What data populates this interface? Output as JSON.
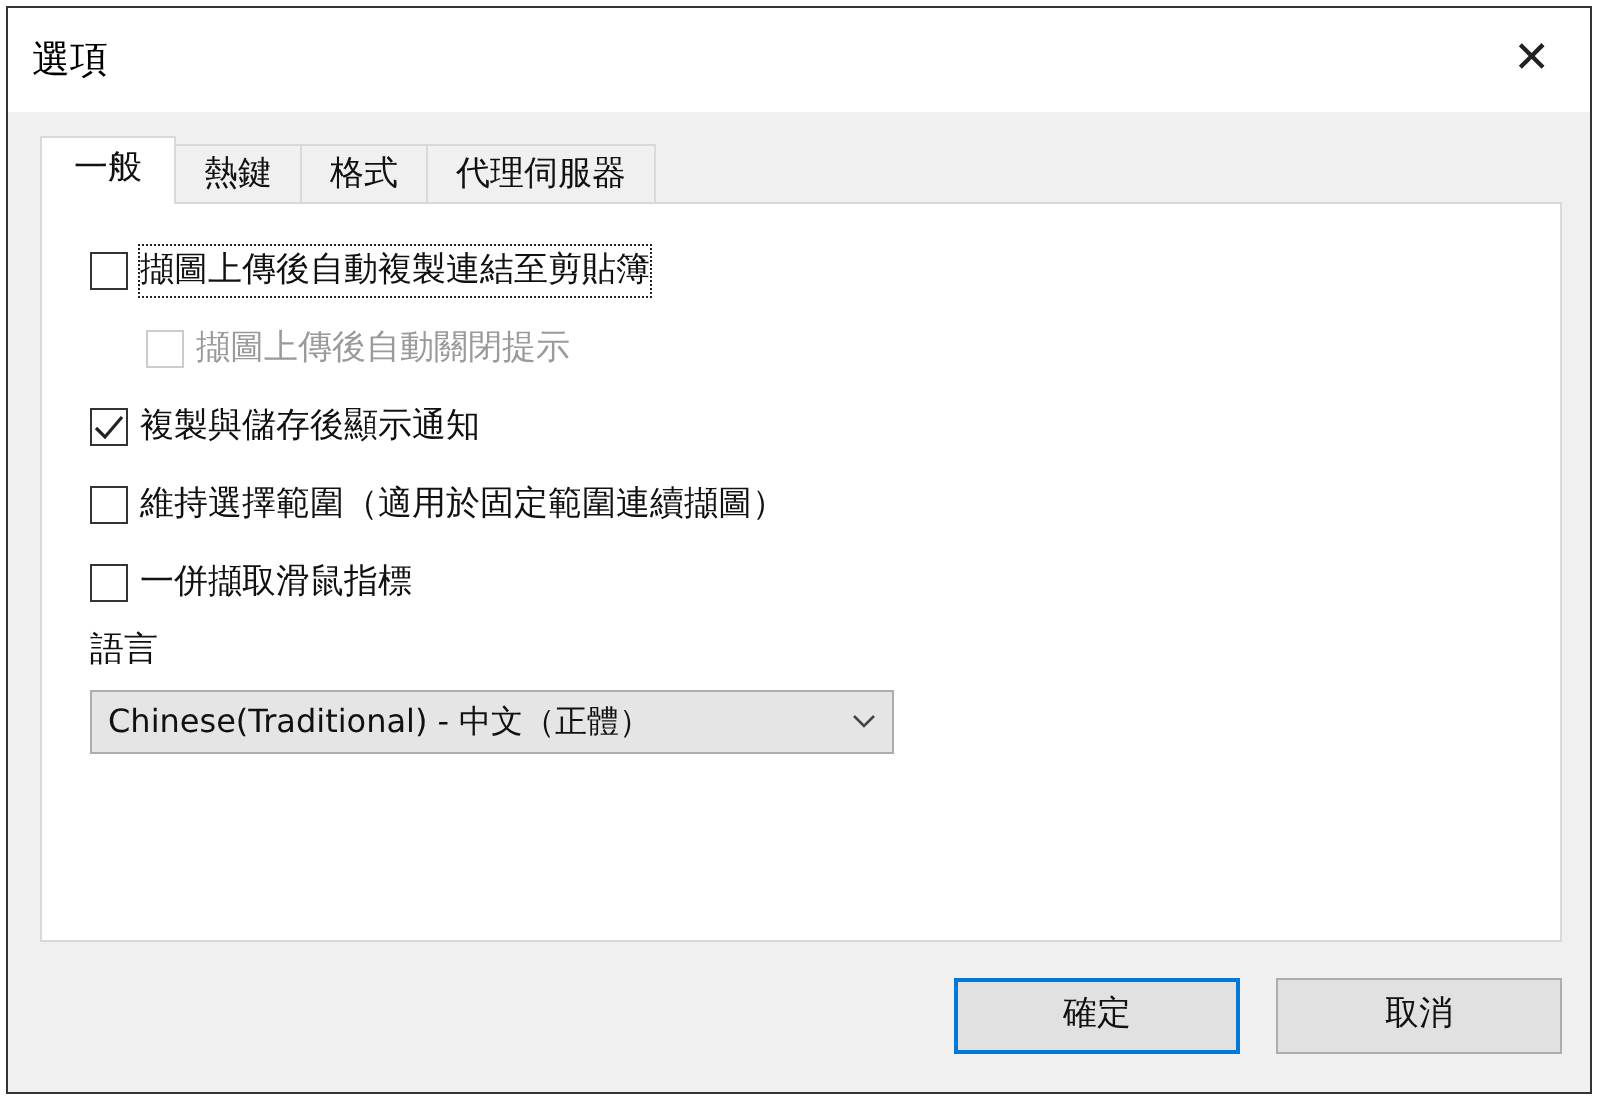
{
  "window": {
    "title": "選項",
    "close": "✕"
  },
  "tabs": [
    {
      "label": "一般",
      "selected": true
    },
    {
      "label": "熱鍵",
      "selected": false
    },
    {
      "label": "格式",
      "selected": false
    },
    {
      "label": "代理伺服器",
      "selected": false
    }
  ],
  "options": [
    {
      "label": "擷圖上傳後自動複製連結至剪貼簿",
      "checked": false,
      "disabled": false,
      "focused": true,
      "children": [
        {
          "label": "擷圖上傳後自動關閉提示",
          "checked": false,
          "disabled": true,
          "focused": false
        }
      ]
    },
    {
      "label": "複製與儲存後顯示通知",
      "checked": true,
      "disabled": false,
      "focused": false
    },
    {
      "label": "維持選擇範圍（適用於固定範圍連續擷圖）",
      "checked": false,
      "disabled": false,
      "focused": false
    },
    {
      "label": "一併擷取滑鼠指標",
      "checked": false,
      "disabled": false,
      "focused": false
    }
  ],
  "language": {
    "label": "語言",
    "value": "Chinese(Traditional) - 中文（正體）"
  },
  "buttons": [
    {
      "label": "確定",
      "default": true
    },
    {
      "label": "取消",
      "default": false
    }
  ]
}
